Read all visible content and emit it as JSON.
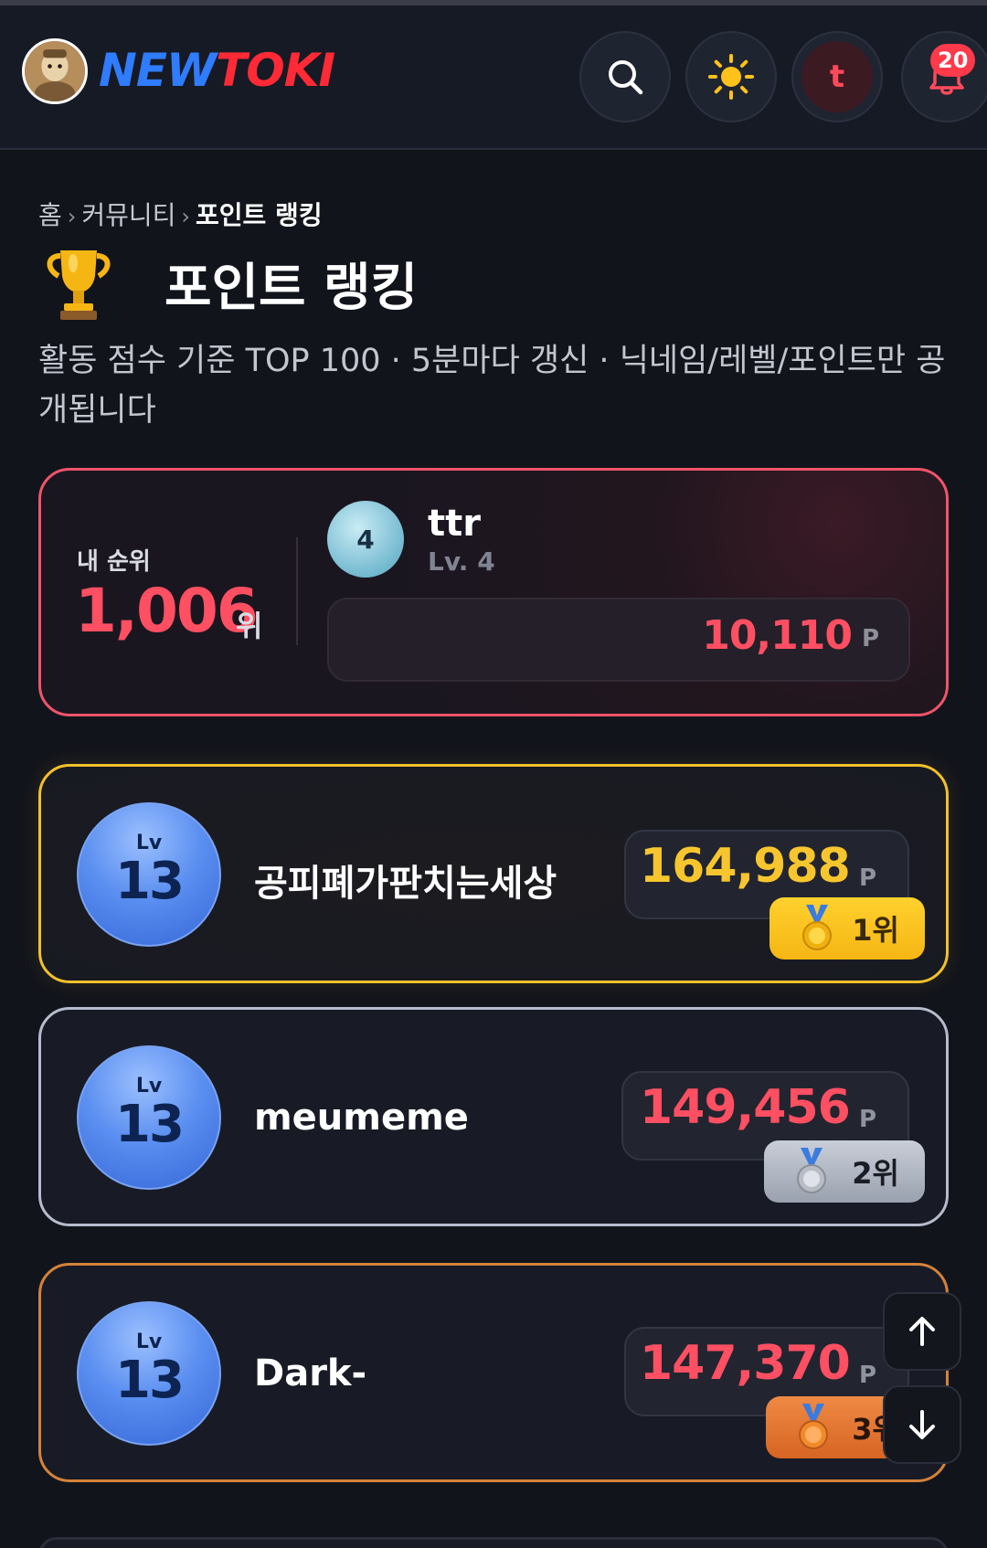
{
  "header": {
    "logo_part1": "NEW",
    "logo_part2": "TOKI",
    "user_initial": "t",
    "notification_count": "20"
  },
  "breadcrumb": {
    "home": "홈",
    "separator": "›",
    "community": "커뮤니티",
    "current": "포인트 랭킹"
  },
  "page": {
    "title": "포인트 랭킹",
    "description": "활동 점수 기준 TOP 100 · 5분마다 갱신 · 닉네임/레벨/포인트만 공개됩니다"
  },
  "my_rank": {
    "label": "내 순위",
    "rank": "1,006",
    "rank_unit": "위",
    "level_badge": "4",
    "nickname": "ttr",
    "level_text": "Lv. 4",
    "points": "10,110",
    "points_unit": "P"
  },
  "ranking": [
    {
      "lv_label": "Lv",
      "level": "13",
      "nickname": "공피폐가판치는세상",
      "points": "164,988",
      "points_unit": "P",
      "rank_label": "1위",
      "medal": "gold"
    },
    {
      "lv_label": "Lv",
      "level": "13",
      "nickname": "meumeme",
      "points": "149,456",
      "points_unit": "P",
      "rank_label": "2위",
      "medal": "silver"
    },
    {
      "lv_label": "Lv",
      "level": "13",
      "nickname": "Dark-",
      "points": "147,370",
      "points_unit": "P",
      "rank_label": "3위",
      "medal": "bronze"
    }
  ],
  "colors": {
    "accent_red": "#ff4f62",
    "gold": "#f2c02a",
    "silver": "#b6bccb",
    "bronze": "#d4823a",
    "background": "#12141c"
  }
}
